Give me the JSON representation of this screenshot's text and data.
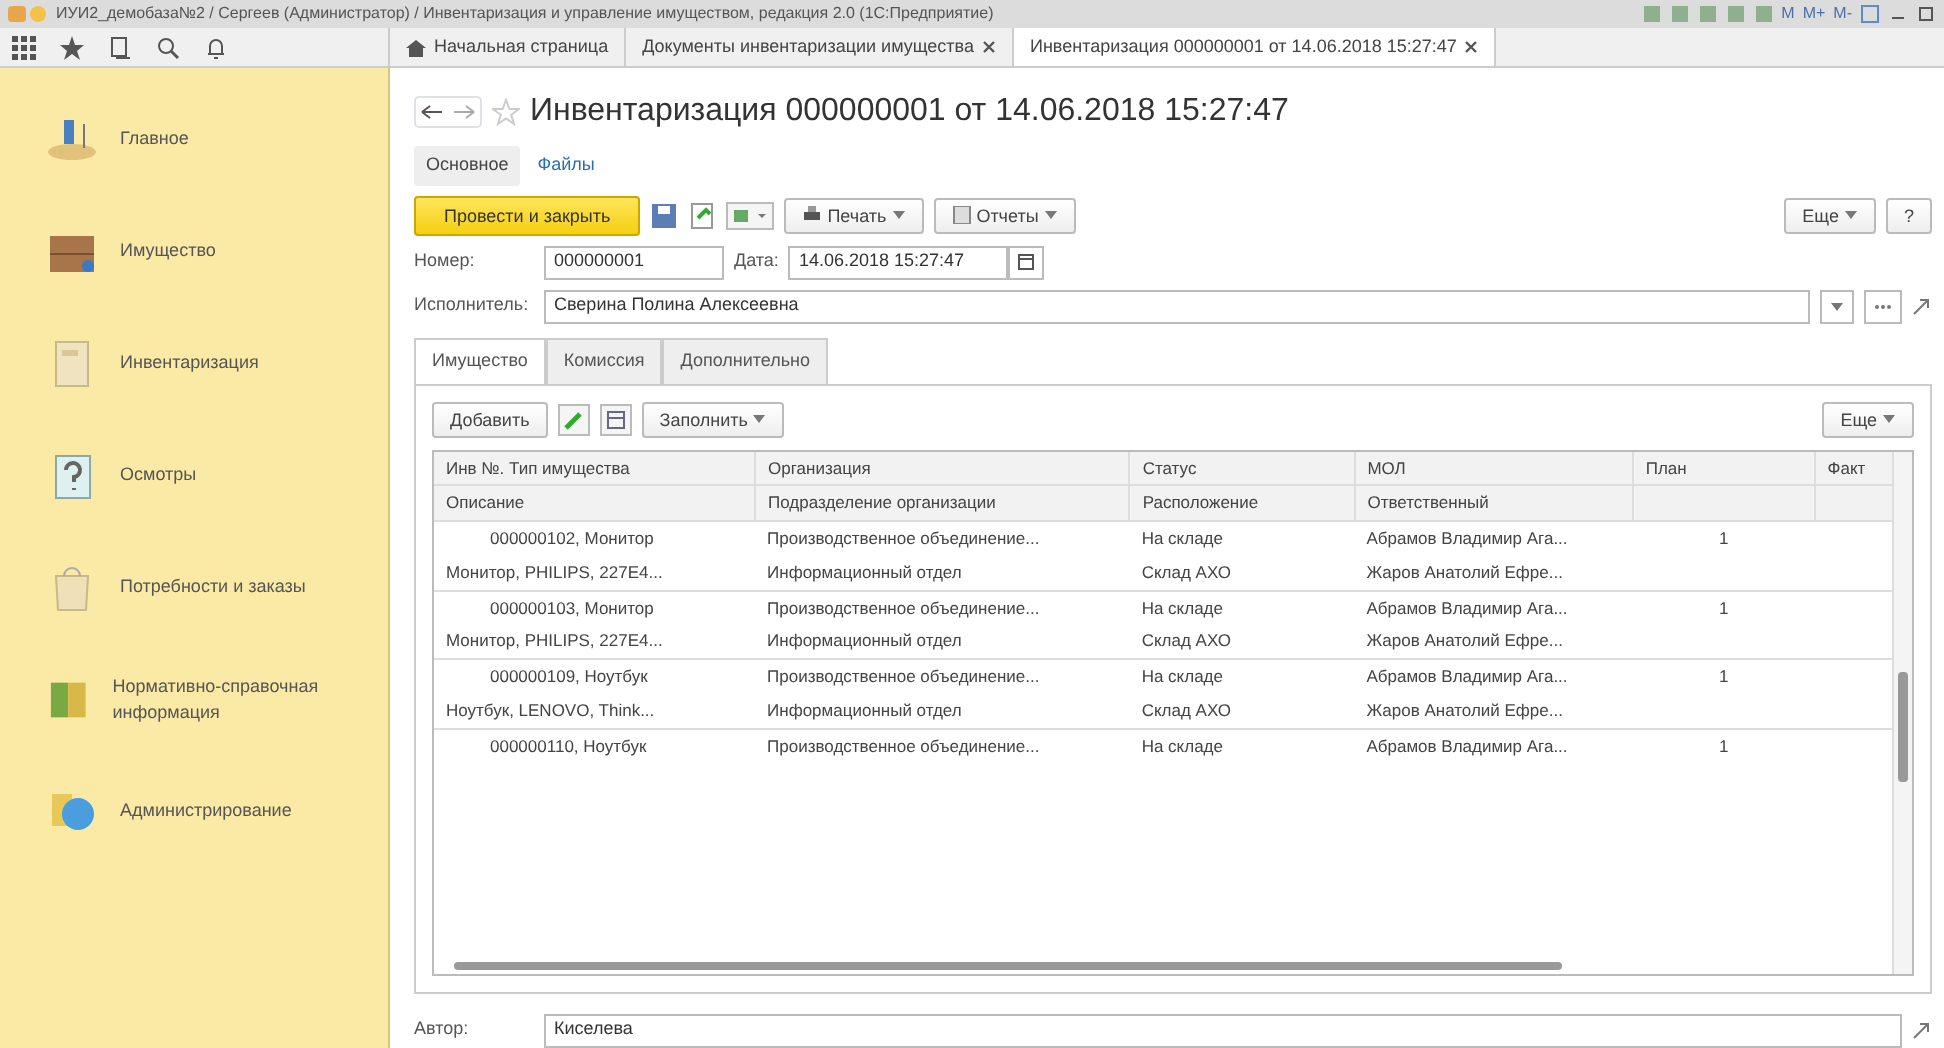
{
  "window": {
    "title": "ИУИ2_демобаза№2 / Сергеев (Администратор) / Инвентаризация и управление имуществом, редакция 2.0 (1С:Предприятие)",
    "memory_buttons": [
      "M",
      "M+",
      "M-"
    ]
  },
  "top_tabs": [
    {
      "label": "Начальная страница",
      "closable": false,
      "selected": false
    },
    {
      "label": "Документы инвентаризации имущества",
      "closable": true,
      "selected": false
    },
    {
      "label": "Инвентаризация 000000001 от 14.06.2018 15:27:47",
      "closable": true,
      "selected": true
    }
  ],
  "sidebar": {
    "items": [
      {
        "label": "Главное"
      },
      {
        "label": "Имущество"
      },
      {
        "label": "Инвентаризация"
      },
      {
        "label": "Осмотры"
      },
      {
        "label": "Потребности и заказы"
      },
      {
        "label": "Нормативно-справочная информация"
      },
      {
        "label": "Администрирование"
      }
    ]
  },
  "form": {
    "title": "Инвентаризация 000000001 от 14.06.2018 15:27:47",
    "sections": [
      {
        "label": "Основное",
        "selected": true
      },
      {
        "label": "Файлы",
        "selected": false
      }
    ],
    "commands": {
      "primary": "Провести и закрыть",
      "print": "Печать",
      "reports": "Отчеты",
      "more": "Еще",
      "help": "?"
    },
    "number": {
      "label": "Номер:",
      "value": "000000001"
    },
    "date": {
      "label": "Дата:",
      "value": "14.06.2018 15:27:47"
    },
    "executor": {
      "label": "Исполнитель:",
      "value": "Сверина Полина Алексеевна"
    },
    "tabs": [
      {
        "label": "Имущество",
        "selected": true
      },
      {
        "label": "Комиссия",
        "selected": false
      },
      {
        "label": "Дополнительно",
        "selected": false
      }
    ],
    "table_commands": {
      "add": "Добавить",
      "fill": "Заполнить",
      "more": "Еще"
    },
    "table": {
      "columns": [
        {
          "line1": "Инв №. Тип имущества",
          "line2": "Описание"
        },
        {
          "line1": "Организация",
          "line2": "Подразделение организации"
        },
        {
          "line1": "Статус",
          "line2": "Расположение"
        },
        {
          "line1": "МОЛ",
          "line2": "Ответственный"
        },
        {
          "line1": "План"
        },
        {
          "line1": "Факт"
        }
      ],
      "rows": [
        {
          "line1": {
            "inventory": "000000102, Монитор",
            "organization": "Производственное объединение...",
            "status": "На складе",
            "mol": "Абрамов Владимир Ага...",
            "plan": "1"
          },
          "line2": {
            "description": "Монитор, PHILIPS, 227E4...",
            "department": "Информационный отдел",
            "location": "Склад АХО",
            "responsible": "Жаров Анатолий Ефре..."
          }
        },
        {
          "line1": {
            "inventory": "000000103, Монитор",
            "organization": "Производственное объединение...",
            "status": "На складе",
            "mol": "Абрамов Владимир Ага...",
            "plan": "1"
          },
          "line2": {
            "description": "Монитор, PHILIPS, 227E4...",
            "department": "Информационный отдел",
            "location": "Склад АХО",
            "responsible": "Жаров Анатолий Ефре..."
          }
        },
        {
          "line1": {
            "inventory": "000000109, Ноутбук",
            "organization": "Производственное объединение...",
            "status": "На складе",
            "mol": "Абрамов Владимир Ага...",
            "plan": "1"
          },
          "line2": {
            "description": "Ноутбук, LENOVO, Think...",
            "department": "Информационный отдел",
            "location": "Склад АХО",
            "responsible": "Жаров Анатолий Ефре..."
          }
        },
        {
          "line1": {
            "inventory": "000000110, Ноутбук",
            "organization": "Производственное объединение...",
            "status": "На складе",
            "mol": "Абрамов Владимир Ага...",
            "plan": "1"
          }
        }
      ]
    },
    "author": {
      "label": "Автор:",
      "value": "Киселева"
    }
  }
}
